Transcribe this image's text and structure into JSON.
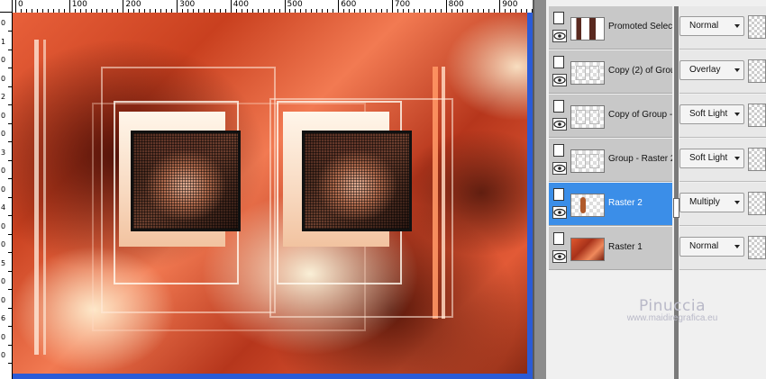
{
  "ruler": {
    "top_labels": [
      "0",
      "100",
      "200",
      "300",
      "400",
      "500",
      "600",
      "700",
      "800",
      "900"
    ],
    "left_labels": [
      "0",
      "1",
      "0",
      "0",
      "2",
      "0",
      "0",
      "3",
      "0",
      "0",
      "4",
      "0",
      "0",
      "5",
      "0",
      "0",
      "6",
      "0",
      "0"
    ]
  },
  "layers": [
    {
      "name": "Promoted Selecti",
      "blend": "Normal",
      "selected": false,
      "thumb": "promoted"
    },
    {
      "name": "Copy (2) of Grou",
      "blend": "Overlay",
      "selected": false,
      "thumb": "frames"
    },
    {
      "name": "Copy of Group -",
      "blend": "Soft Light",
      "selected": false,
      "thumb": "frames"
    },
    {
      "name": "Group - Raster 2",
      "blend": "Soft Light",
      "selected": false,
      "thumb": "frames"
    },
    {
      "name": "Raster 2",
      "blend": "Multiply",
      "selected": true,
      "thumb": "figure"
    },
    {
      "name": "Raster 1",
      "blend": "Normal",
      "selected": false,
      "thumb": "orange"
    }
  ],
  "watermark": {
    "title": "Pinuccia",
    "url": "www.maidiregrafica.eu"
  },
  "colors": {
    "selected_row": "#3b8ee8",
    "scrollbar": "#2a5bd7"
  }
}
